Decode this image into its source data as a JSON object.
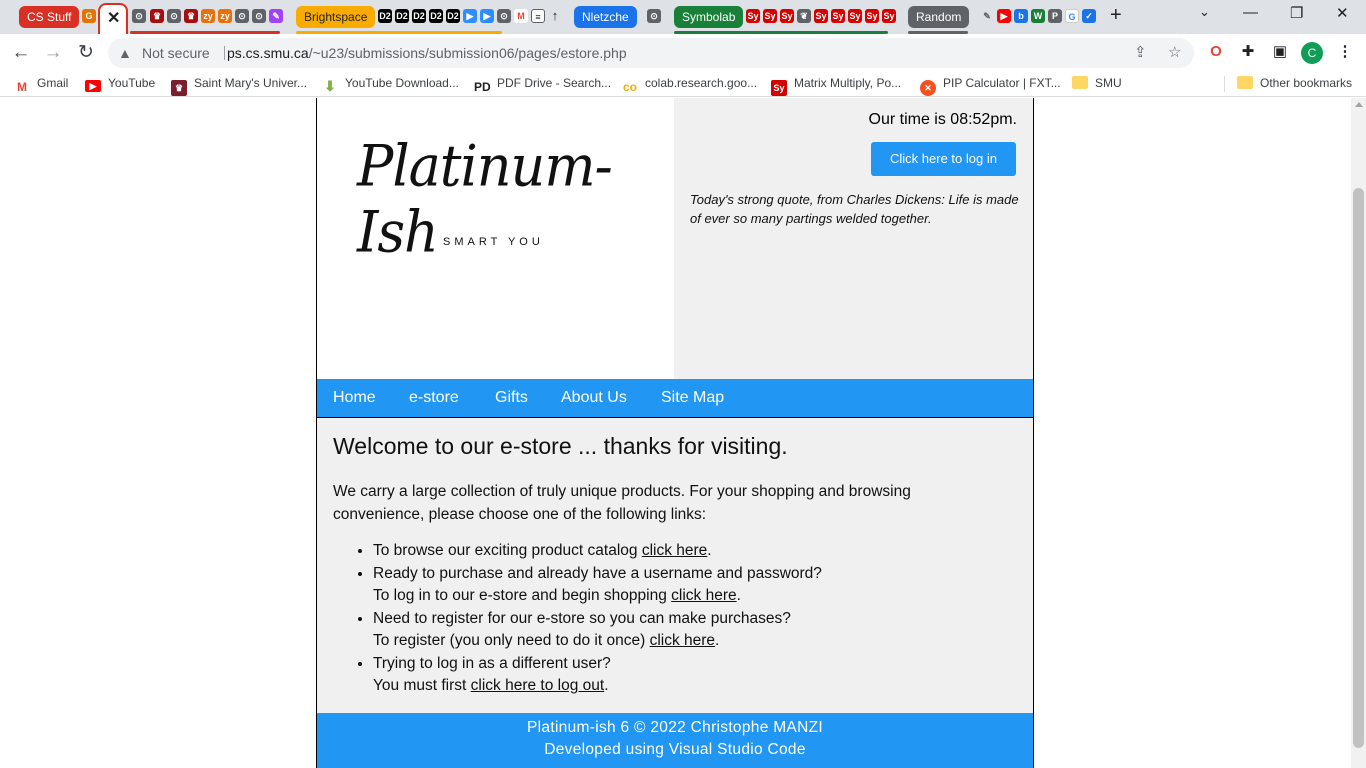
{
  "browser": {
    "tab_groups": [
      {
        "label": "CS Stuff",
        "color": "#d93025"
      },
      {
        "label": "Brightspace",
        "color": "#f9ab00"
      },
      {
        "label": "Nletzche",
        "color": "#1a73e8"
      },
      {
        "label": "Symbolab",
        "color": "#188038"
      },
      {
        "label": "Random",
        "color": "#5f6368"
      }
    ],
    "active_tab_close": "✕",
    "new_tab": "+",
    "window_controls": {
      "minimize": "—",
      "restore": "❐",
      "close": "✕"
    },
    "nav": {
      "back": "←",
      "forward": "→",
      "reload": "↻"
    },
    "security_label": "Not secure",
    "url_host": "ps.cs.smu.ca",
    "url_path": "/~u23/submissions/submission06/pages/estore.php",
    "profile_initial": "C",
    "bookmarks": [
      {
        "label": "Gmail",
        "icon": "gmail-icon"
      },
      {
        "label": "YouTube",
        "icon": "youtube-icon"
      },
      {
        "label": "Saint Mary's Univer...",
        "icon": "smu-crest-icon"
      },
      {
        "label": "YouTube Download...",
        "icon": "download-arrow-icon"
      },
      {
        "label": "PDF Drive - Search...",
        "icon": "pdf-drive-icon"
      },
      {
        "label": "colab.research.goo...",
        "icon": "colab-icon"
      },
      {
        "label": "Matrix Multiply, Po...",
        "icon": "symbolab-icon"
      },
      {
        "label": "PIP Calculator | FXT...",
        "icon": "fx-icon"
      },
      {
        "label": "SMU",
        "icon": "folder-icon"
      },
      {
        "label": "Other bookmarks",
        "icon": "folder-icon"
      }
    ]
  },
  "page": {
    "time_line": "Our time is 08:52pm.",
    "login_button": "Click here to log in",
    "quote": "Today's strong quote, from Charles Dickens: Life is made of ever so many partings welded together.",
    "logo_text": "Platinum-Ish",
    "logo_sub": "SMART YOU",
    "nav": [
      "Home",
      "e-store",
      "Gifts",
      "About Us",
      "Site Map"
    ],
    "welcome": "Welcome to our e-store ... thanks for visiting.",
    "intro": "We carry a large collection of truly unique products. For your shopping and browsing convenience, please choose one of the following links:",
    "items": [
      {
        "line1": "To browse our exciting product catalog ",
        "link": "click here",
        "end": "."
      },
      {
        "line1": "Ready to purchase and already have a username and password?",
        "line2": "To log in to our e-store and begin shopping ",
        "link": "click here",
        "end": "."
      },
      {
        "line1": "Need to register for our e-store so you can make purchases?",
        "line2": "To register (you only need to do it once) ",
        "link": "click here",
        "end": "."
      },
      {
        "line1": "Trying to log in as a different user?",
        "line2": "You must first ",
        "link": "click here to log out",
        "end": "."
      }
    ],
    "footer_line1": "Platinum-ish 6 © 2022 Christophe MANZI",
    "footer_line2": "Developed using Visual Studio Code",
    "accent_color": "#2196f3"
  }
}
